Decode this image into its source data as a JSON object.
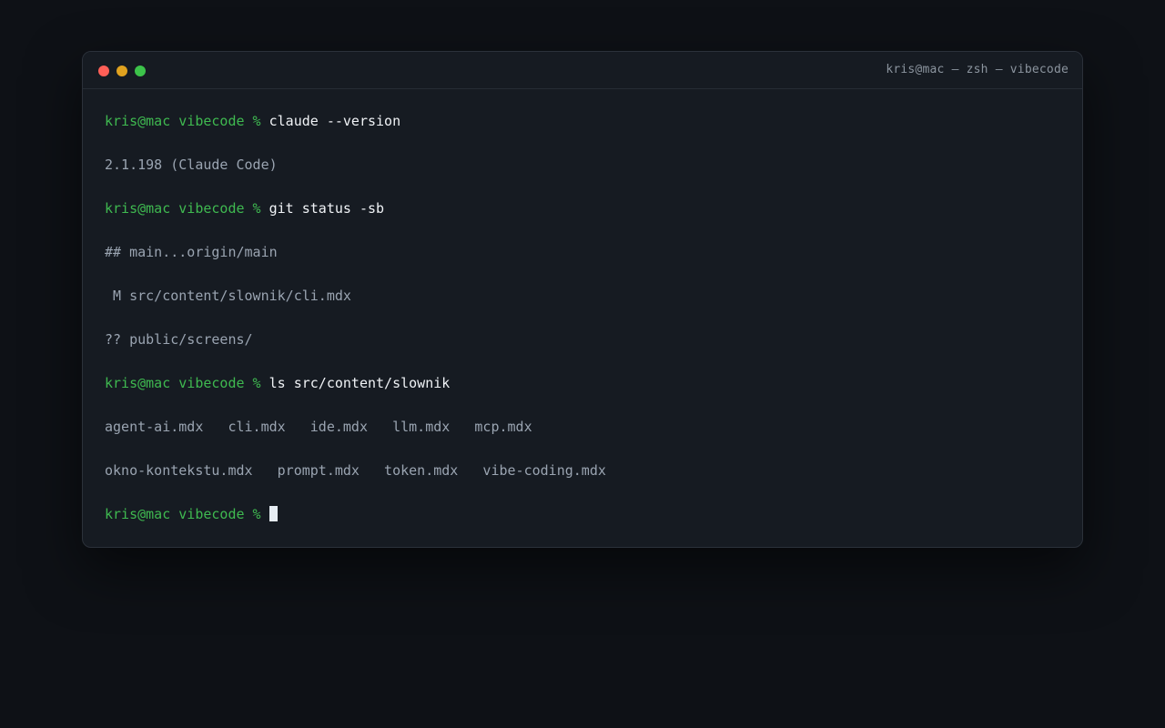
{
  "window": {
    "title": "kris@mac — zsh — vibecode",
    "controls": {
      "close_icon": "close-dot",
      "minimize_icon": "minimize-dot",
      "maximize_icon": "maximize-dot",
      "colors": {
        "close": "#ff5f57",
        "minimize": "#e0a21f",
        "maximize": "#3cc34a"
      }
    }
  },
  "terminal": {
    "prompt": "kris@mac vibecode % ",
    "prompt_color": "#3fb950",
    "lines": [
      {
        "type": "command",
        "prompt": "kris@mac vibecode % ",
        "text": "claude --version"
      },
      {
        "type": "output",
        "text": "2.1.198 (Claude Code)"
      },
      {
        "type": "command",
        "prompt": "kris@mac vibecode % ",
        "text": "git status -sb"
      },
      {
        "type": "output",
        "text": "## main...origin/main"
      },
      {
        "type": "output",
        "text": " M src/content/slownik/cli.mdx"
      },
      {
        "type": "output",
        "text": "?? public/screens/"
      },
      {
        "type": "command",
        "prompt": "kris@mac vibecode % ",
        "text": "ls src/content/slownik"
      },
      {
        "type": "output",
        "text": "agent-ai.mdx   cli.mdx   ide.mdx   llm.mdx   mcp.mdx"
      },
      {
        "type": "output",
        "text": "okno-kontekstu.mdx   prompt.mdx   token.mdx   vibe-coding.mdx"
      },
      {
        "type": "command",
        "prompt": "kris@mac vibecode % ",
        "text": "",
        "cursor": true
      }
    ]
  }
}
